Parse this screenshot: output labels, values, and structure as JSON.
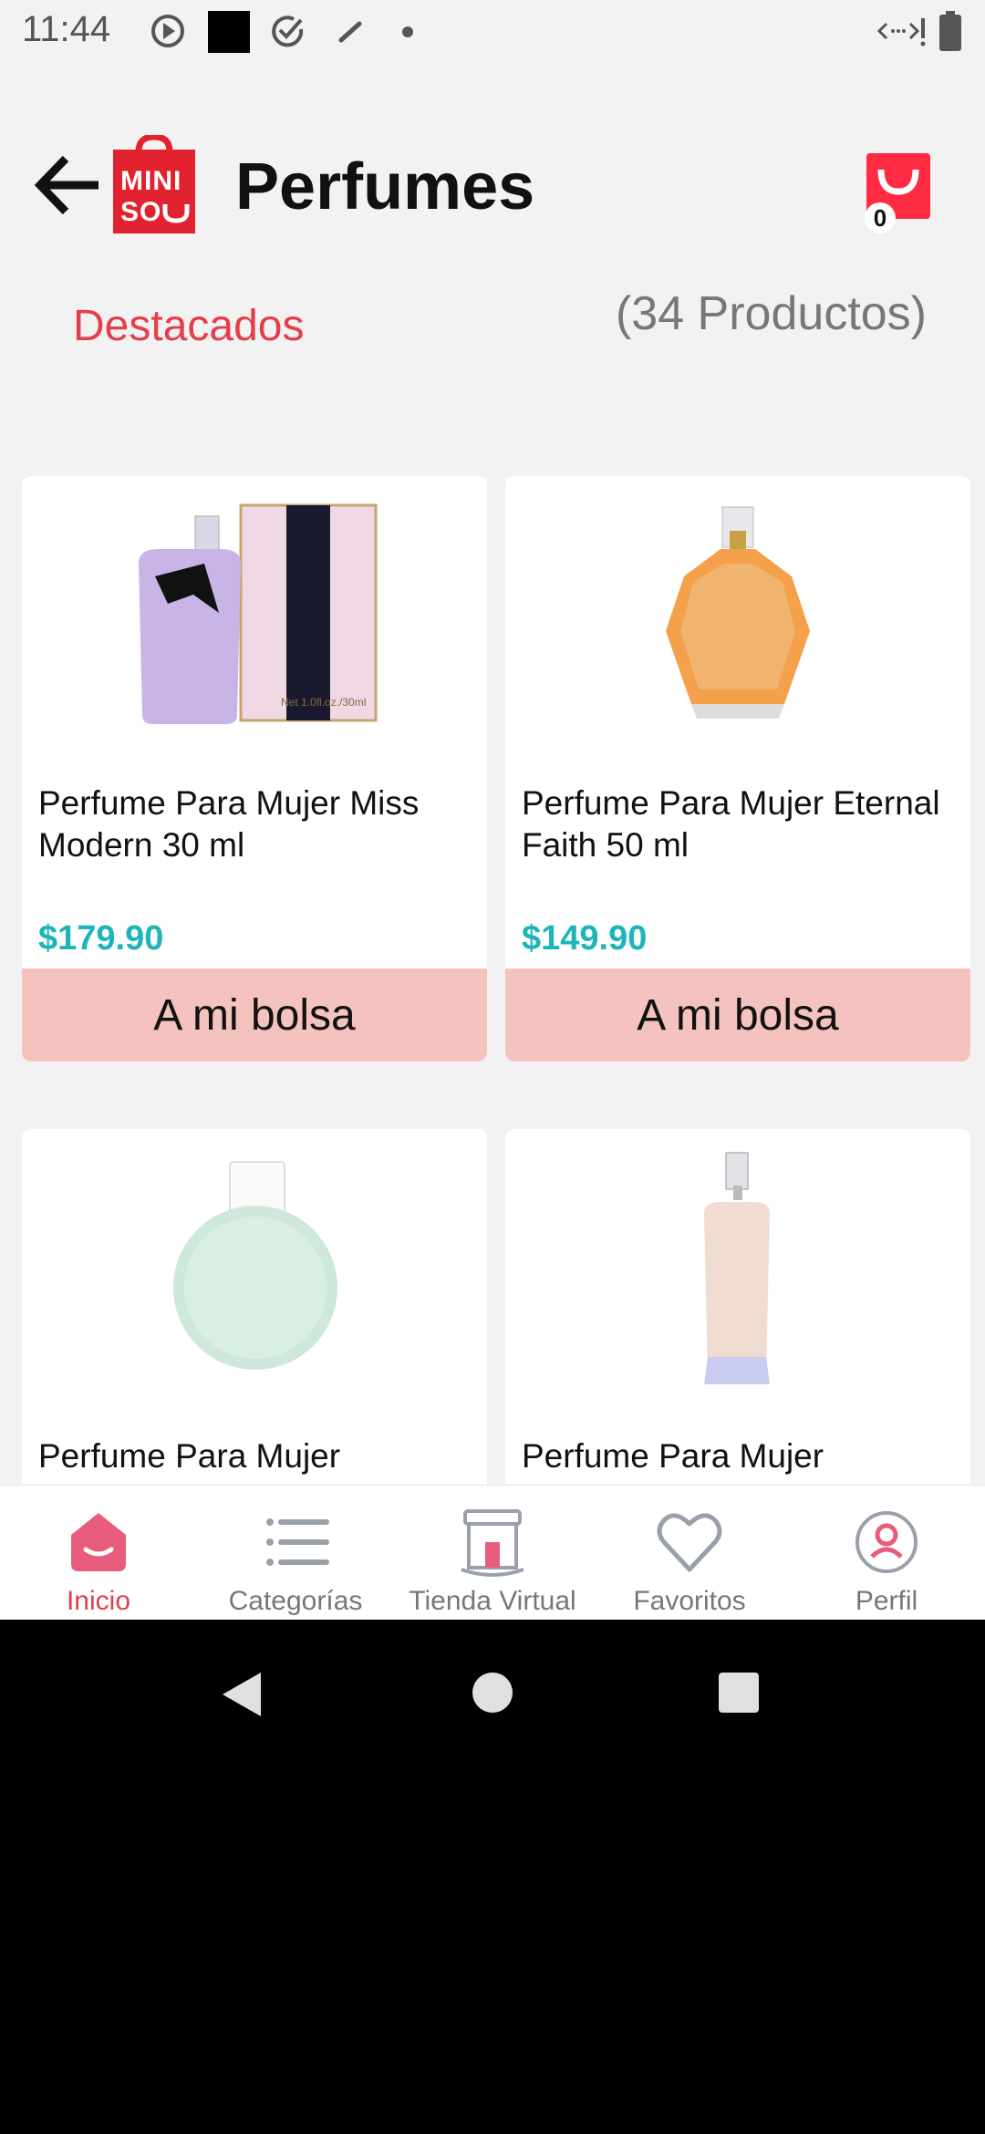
{
  "status_bar": {
    "time": "11:44"
  },
  "header": {
    "title": "Perfumes",
    "logo_text_line1": "MINI",
    "logo_text_line2": "SO",
    "cart_count": "0"
  },
  "filters": {
    "sort_label": "Destacados",
    "product_count": "(34 Productos)"
  },
  "products": [
    {
      "name": "Perfume Para Mujer Miss Modern 30 ml",
      "price": "$179.90",
      "button": "A mi bolsa",
      "image": "perfume-miss-modern"
    },
    {
      "name": "Perfume Para Mujer Eternal Faith 50 ml",
      "price": "$149.90",
      "button": "A mi bolsa",
      "image": "perfume-eternal-faith"
    },
    {
      "name": "Perfume Para Mujer",
      "image": "perfume-round-green"
    },
    {
      "name": "Perfume Para Mujer",
      "image": "perfume-tall-clear"
    }
  ],
  "bottom_nav": [
    {
      "label": "Inicio",
      "icon": "home-icon",
      "active": true
    },
    {
      "label": "Categorías",
      "icon": "categories-icon"
    },
    {
      "label": "Tienda Virtual",
      "icon": "store-icon"
    },
    {
      "label": "Favoritos",
      "icon": "heart-icon"
    },
    {
      "label": "Perfil",
      "icon": "profile-icon"
    }
  ],
  "colors": {
    "brand_red": "#e53e4b",
    "price_teal": "#1fb5b8",
    "button_pink": "#f5c3bf",
    "background": "#f2f2f2"
  }
}
